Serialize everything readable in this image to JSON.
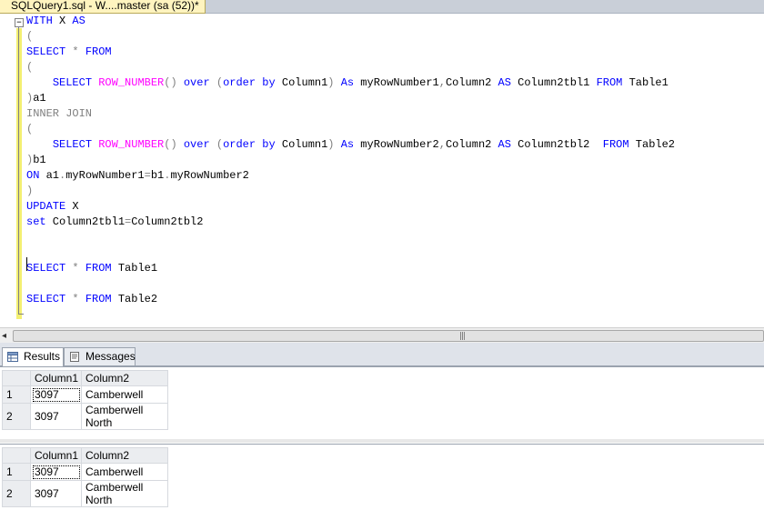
{
  "window": {
    "tab_title": "SQLQuery1.sql - W....master (sa (52))*"
  },
  "editor": {
    "collapse_symbol": "−",
    "lines": [
      [
        {
          "c": "kw",
          "t": "WITH"
        },
        {
          "c": "tx",
          "t": " X "
        },
        {
          "c": "kw",
          "t": "AS"
        }
      ],
      [
        {
          "c": "gr",
          "t": "("
        }
      ],
      [
        {
          "c": "kw",
          "t": "SELECT"
        },
        {
          "c": "tx",
          "t": " "
        },
        {
          "c": "gr",
          "t": "*"
        },
        {
          "c": "tx",
          "t": " "
        },
        {
          "c": "kw",
          "t": "FROM"
        }
      ],
      [
        {
          "c": "gr",
          "t": "("
        }
      ],
      [
        {
          "c": "tx",
          "t": "    "
        },
        {
          "c": "kw",
          "t": "SELECT"
        },
        {
          "c": "tx",
          "t": " "
        },
        {
          "c": "fn",
          "t": "ROW_NUMBER"
        },
        {
          "c": "gr",
          "t": "()"
        },
        {
          "c": "tx",
          "t": " "
        },
        {
          "c": "kw",
          "t": "over"
        },
        {
          "c": "tx",
          "t": " "
        },
        {
          "c": "gr",
          "t": "("
        },
        {
          "c": "kw",
          "t": "order by"
        },
        {
          "c": "tx",
          "t": " Column1"
        },
        {
          "c": "gr",
          "t": ")"
        },
        {
          "c": "tx",
          "t": " "
        },
        {
          "c": "kw",
          "t": "As"
        },
        {
          "c": "tx",
          "t": " myRowNumber1"
        },
        {
          "c": "gr",
          "t": ","
        },
        {
          "c": "tx",
          "t": "Column2 "
        },
        {
          "c": "kw",
          "t": "AS"
        },
        {
          "c": "tx",
          "t": " Column2tbl1 "
        },
        {
          "c": "kw",
          "t": "FROM"
        },
        {
          "c": "tx",
          "t": " Table1"
        }
      ],
      [
        {
          "c": "gr",
          "t": ")"
        },
        {
          "c": "tx",
          "t": "a1"
        }
      ],
      [
        {
          "c": "gr",
          "t": "INNER JOIN"
        }
      ],
      [
        {
          "c": "gr",
          "t": "("
        }
      ],
      [
        {
          "c": "tx",
          "t": "    "
        },
        {
          "c": "kw",
          "t": "SELECT"
        },
        {
          "c": "tx",
          "t": " "
        },
        {
          "c": "fn",
          "t": "ROW_NUMBER"
        },
        {
          "c": "gr",
          "t": "()"
        },
        {
          "c": "tx",
          "t": " "
        },
        {
          "c": "kw",
          "t": "over"
        },
        {
          "c": "tx",
          "t": " "
        },
        {
          "c": "gr",
          "t": "("
        },
        {
          "c": "kw",
          "t": "order by"
        },
        {
          "c": "tx",
          "t": " Column1"
        },
        {
          "c": "gr",
          "t": ")"
        },
        {
          "c": "tx",
          "t": " "
        },
        {
          "c": "kw",
          "t": "As"
        },
        {
          "c": "tx",
          "t": " myRowNumber2"
        },
        {
          "c": "gr",
          "t": ","
        },
        {
          "c": "tx",
          "t": "Column2 "
        },
        {
          "c": "kw",
          "t": "AS"
        },
        {
          "c": "tx",
          "t": " Column2tbl2  "
        },
        {
          "c": "kw",
          "t": "FROM"
        },
        {
          "c": "tx",
          "t": " Table2"
        }
      ],
      [
        {
          "c": "gr",
          "t": ")"
        },
        {
          "c": "tx",
          "t": "b1"
        }
      ],
      [
        {
          "c": "kw",
          "t": "ON"
        },
        {
          "c": "tx",
          "t": " a1"
        },
        {
          "c": "gr",
          "t": "."
        },
        {
          "c": "tx",
          "t": "myRowNumber1"
        },
        {
          "c": "gr",
          "t": "="
        },
        {
          "c": "tx",
          "t": "b1"
        },
        {
          "c": "gr",
          "t": "."
        },
        {
          "c": "tx",
          "t": "myRowNumber2"
        }
      ],
      [
        {
          "c": "gr",
          "t": ")"
        }
      ],
      [
        {
          "c": "kw",
          "t": "UPDATE"
        },
        {
          "c": "tx",
          "t": " X"
        }
      ],
      [
        {
          "c": "kw",
          "t": "set"
        },
        {
          "c": "tx",
          "t": " Column2tbl1"
        },
        {
          "c": "gr",
          "t": "="
        },
        {
          "c": "tx",
          "t": "Column2tbl2"
        }
      ],
      [],
      [],
      [
        {
          "c": "kw",
          "t": "SELECT"
        },
        {
          "c": "tx",
          "t": " "
        },
        {
          "c": "gr",
          "t": "*"
        },
        {
          "c": "tx",
          "t": " "
        },
        {
          "c": "kw",
          "t": "FROM"
        },
        {
          "c": "tx",
          "t": " Table1"
        }
      ],
      [],
      [
        {
          "c": "kw",
          "t": "SELECT"
        },
        {
          "c": "tx",
          "t": " "
        },
        {
          "c": "gr",
          "t": "*"
        },
        {
          "c": "tx",
          "t": " "
        },
        {
          "c": "kw",
          "t": "FROM"
        },
        {
          "c": "tx",
          "t": " Table2"
        }
      ]
    ]
  },
  "scrollbar": {
    "left_arrow": "◂",
    "grip": "|||"
  },
  "results_tabs": {
    "results_label": "Results",
    "messages_label": "Messages"
  },
  "grid1": {
    "headers": [
      "Column1",
      "Column2"
    ],
    "rows": [
      {
        "num": "1",
        "col1": "3097",
        "col2": "Camberwell"
      },
      {
        "num": "2",
        "col1": "3097",
        "col2": "Camberwell North"
      }
    ]
  },
  "grid2": {
    "headers": [
      "Column1",
      "Column2"
    ],
    "rows": [
      {
        "num": "1",
        "col1": "3097",
        "col2": "Camberwell"
      },
      {
        "num": "2",
        "col1": "3097",
        "col2": "Camberwell North"
      }
    ]
  },
  "colors": {
    "keyword": "#0000ff",
    "function": "#ff00ff",
    "operator": "#808080",
    "modified_bar": "#f3ef71"
  }
}
